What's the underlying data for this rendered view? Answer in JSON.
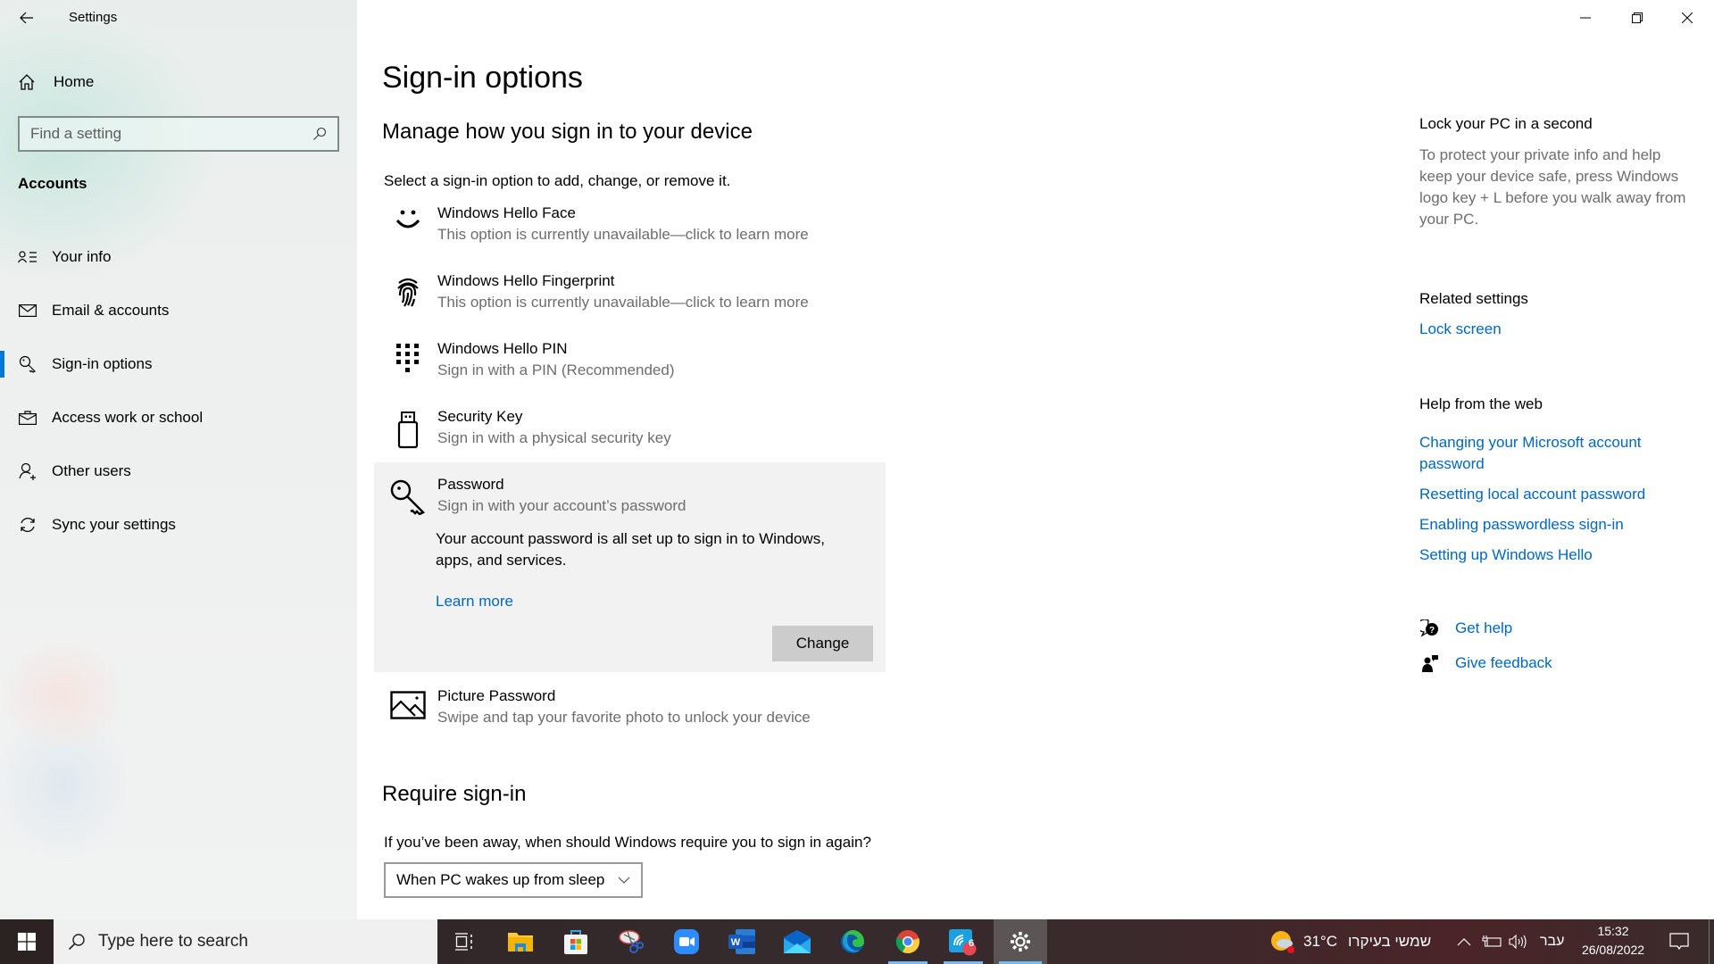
{
  "window": {
    "title": "Settings",
    "controls": {
      "minimize": "minimize",
      "restore": "restore",
      "close": "close"
    }
  },
  "sidebar": {
    "home_label": "Home",
    "search_placeholder": "Find a setting",
    "section": "Accounts",
    "items": [
      {
        "label": "Your info",
        "icon": "person-list-icon",
        "active": false
      },
      {
        "label": "Email & accounts",
        "icon": "mail-icon",
        "active": false
      },
      {
        "label": "Sign-in options",
        "icon": "key-icon",
        "active": true
      },
      {
        "label": "Access work or school",
        "icon": "briefcase-icon",
        "active": false
      },
      {
        "label": "Other users",
        "icon": "add-person-icon",
        "active": false
      },
      {
        "label": "Sync your settings",
        "icon": "sync-icon",
        "active": false
      }
    ]
  },
  "main": {
    "title": "Sign-in options",
    "subtitle": "Manage how you sign in to your device",
    "description": "Select a sign-in option to add, change, or remove it.",
    "options": [
      {
        "name": "Windows Hello Face",
        "sub": "This option is currently unavailable—click to learn more",
        "icon": "face-icon"
      },
      {
        "name": "Windows Hello Fingerprint",
        "sub": "This option is currently unavailable—click to learn more",
        "icon": "fingerprint-icon"
      },
      {
        "name": "Windows Hello PIN",
        "sub": "Sign in with a PIN (Recommended)",
        "icon": "pin-keypad-icon"
      },
      {
        "name": "Security Key",
        "sub": "Sign in with a physical security key",
        "icon": "usb-key-icon"
      },
      {
        "name": "Password",
        "sub": "Sign in with your account’s password",
        "icon": "password-key-icon",
        "expanded": true
      },
      {
        "name": "Picture Password",
        "sub": "Swipe and tap your favorite photo to unlock your device",
        "icon": "picture-icon"
      }
    ],
    "password_panel": {
      "body": "Your account password is all set up to sign in to Windows, apps, and services.",
      "learn_more": "Learn more",
      "change_button": "Change"
    },
    "require_signin": {
      "title": "Require sign-in",
      "question": "If you’ve been away, when should Windows require you to sign in again?",
      "selected": "When PC wakes up from sleep"
    }
  },
  "right_panel": {
    "lock_title": "Lock your PC in a second",
    "lock_text": "To protect your private info and help keep your device safe, press Windows logo key + L before you walk away from your PC.",
    "related_title": "Related settings",
    "related_links": [
      "Lock screen"
    ],
    "help_title": "Help from the web",
    "help_links": [
      "Changing your Microsoft account password",
      "Resetting local account password",
      "Enabling passwordless sign-in",
      "Setting up Windows Hello"
    ],
    "get_help": "Get help",
    "give_feedback": "Give feedback"
  },
  "taskbar": {
    "search_placeholder": "Type here to search",
    "apps": [
      {
        "name": "Task View",
        "icon": "task-view-icon"
      },
      {
        "name": "File Explorer",
        "icon": "folder-icon"
      },
      {
        "name": "Microsoft Store",
        "icon": "store-icon"
      },
      {
        "name": "Snipping Tool",
        "icon": "snipping-tool-icon"
      },
      {
        "name": "Zoom",
        "icon": "zoom-video-icon"
      },
      {
        "name": "Word",
        "icon": "word-icon"
      },
      {
        "name": "Mail",
        "icon": "mail-app-icon"
      },
      {
        "name": "Edge",
        "icon": "edge-icon"
      },
      {
        "name": "Chrome",
        "icon": "chrome-icon"
      },
      {
        "name": "Phone app",
        "icon": "phone-app-icon",
        "badge": "6"
      },
      {
        "name": "Settings",
        "icon": "settings-gear-icon"
      }
    ],
    "weather": {
      "temp": "31°C",
      "condition": "שמשי בעיקרו"
    },
    "language": "עבר",
    "time": "15:32",
    "date": "26/08/2022"
  },
  "colors": {
    "accent": "#0078d7",
    "link": "#0067c0",
    "secondary_text": "#6d6d6d"
  }
}
